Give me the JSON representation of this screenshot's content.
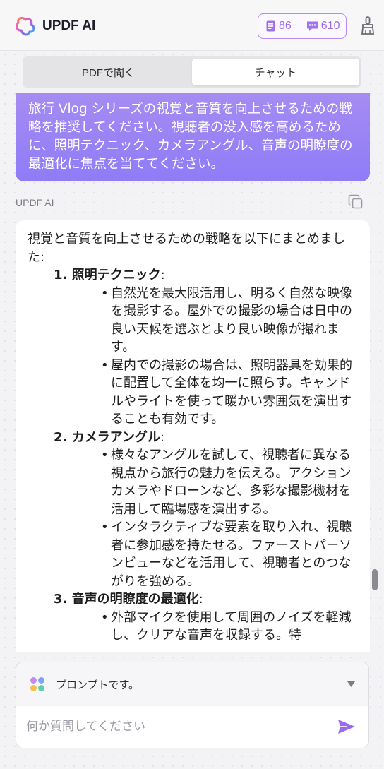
{
  "header": {
    "app_title": "UPDF AI",
    "doc_credits": "86",
    "chat_credits": "610",
    "accent": "#9d6ae8"
  },
  "tabs": [
    {
      "label": "PDFで聞く",
      "active": false
    },
    {
      "label": "チャット",
      "active": true
    }
  ],
  "user_message": "旅行 Vlog シリーズの視覚と音質を向上させるための戦略を推奨してください。視聴者の没入感を高めるために、照明テクニック、カメラアングル、音声の明瞭度の最適化に焦点を当ててください。",
  "ai": {
    "label": "UPDF AI",
    "intro": "視覚と音質を向上させるための戦略を以下にまとめました:",
    "sections": [
      {
        "title": "1. 照明テクニック",
        "colon": ":",
        "bullets": [
          "自然光を最大限活用し、明るく自然な映像を撮影する。屋外での撮影の場合は日中の良い天候を選ぶとより良い映像が撮れます。",
          "屋内での撮影の場合は、照明器具を効果的に配置して全体を均一に照らす。キャンドルやライトを使って暖かい雰囲気を演出することも有効です。"
        ]
      },
      {
        "title": "2. カメラアングル",
        "colon": ":",
        "bullets": [
          "様々なアングルを試して、視聴者に異なる視点から旅行の魅力を伝える。アクションカメラやドローンなど、多彩な撮影機材を活用して臨場感を演出する。",
          "インタラクティブな要素を取り入れ、視聴者に参加感を持たせる。ファーストパーソンビューなどを活用して、視聴者とのつながりを強める。"
        ]
      },
      {
        "title": "3. 音声の明瞭度の最適化",
        "colon": ":",
        "bullets": [
          "外部マイクを使用して周囲のノイズを軽減し、クリアな音声を収録する。特"
        ]
      }
    ]
  },
  "bottom": {
    "prompt_label": "プロンプトです。",
    "input_placeholder": "何か質問してください",
    "send_color": "#9b6af0"
  }
}
